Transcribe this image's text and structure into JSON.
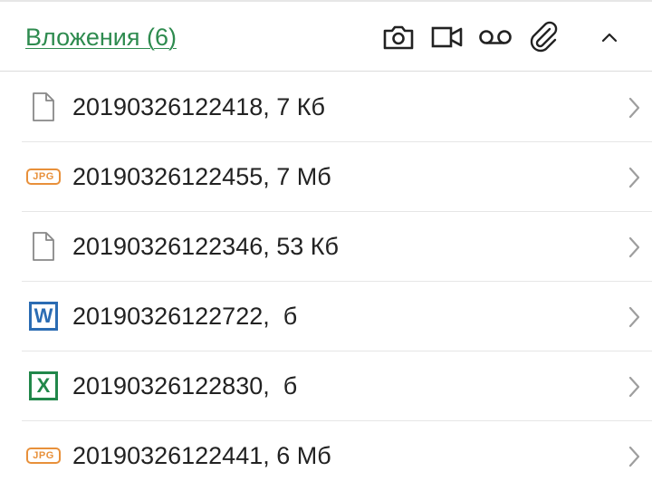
{
  "header": {
    "title": "Вложения (6)",
    "title_color": "#2e8b4f",
    "actions": [
      {
        "icon": "camera-icon"
      },
      {
        "icon": "video-camera-icon"
      },
      {
        "icon": "voicemail-icon"
      },
      {
        "icon": "paperclip-icon"
      },
      {
        "icon": "chevron-up-icon"
      }
    ]
  },
  "attachments": [
    {
      "file_type": "generic",
      "icon": "document-icon",
      "name": "20190326122418, 7 Кб"
    },
    {
      "file_type": "jpg",
      "icon": "jpg-icon",
      "badge": "JPG",
      "name": "20190326122455, 7 Мб"
    },
    {
      "file_type": "generic",
      "icon": "document-icon",
      "name": "20190326122346, 53 Кб"
    },
    {
      "file_type": "word",
      "icon": "word-icon",
      "badge": "W",
      "name": "20190326122722,  б"
    },
    {
      "file_type": "excel",
      "icon": "excel-icon",
      "badge": "X",
      "name": "20190326122830,  б"
    },
    {
      "file_type": "jpg",
      "icon": "jpg-icon",
      "badge": "JPG",
      "name": "20190326122441, 6 Мб"
    }
  ],
  "colors": {
    "jpg": "#e8903a",
    "word": "#2b6cb3",
    "excel": "#21874a",
    "chevron": "#9e9e9e"
  }
}
